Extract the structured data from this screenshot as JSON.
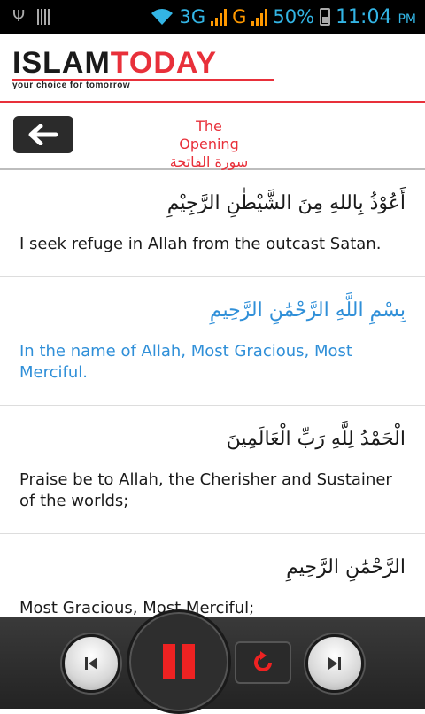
{
  "status_bar": {
    "network_3g": "3G",
    "network_g": "G",
    "battery": "50%",
    "time": "11:04",
    "ampm": "PM"
  },
  "header": {
    "logo_islam": "ISLAM",
    "logo_today": "TODAY",
    "tagline": "your choice for tomorrow"
  },
  "surah": {
    "title_en": "The Opening",
    "title_ar": "سورة الفاتحة"
  },
  "verses": [
    {
      "arabic": "أَعُوْذُ بِاللهِ مِنَ الشَّيْطٰنِ الرَّجِيْمِ",
      "english": "I seek refuge in Allah from the outcast Satan.",
      "active": false
    },
    {
      "arabic": "بِسْمِ اللَّهِ الرَّحْمَٰنِ الرَّحِيمِ",
      "english": "In the name of Allah, Most Gracious, Most Merciful.",
      "active": true
    },
    {
      "arabic": "الْحَمْدُ لِلَّهِ رَبِّ الْعَالَمِينَ",
      "english": "Praise be to Allah, the Cherisher and Sustainer of the worlds;",
      "active": false
    },
    {
      "arabic": "الرَّحْمَٰنِ الرَّحِيمِ",
      "english": "Most Gracious, Most Merciful;",
      "active": false
    }
  ],
  "colors": {
    "brand_red": "#e8303a",
    "active_blue": "#2f8fd8",
    "status_blue": "#33b5e5"
  },
  "icons": {
    "back": "arrow-left-icon",
    "prev": "skip-previous-icon",
    "pause": "pause-icon",
    "repeat": "repeat-icon",
    "next": "skip-next-icon"
  }
}
